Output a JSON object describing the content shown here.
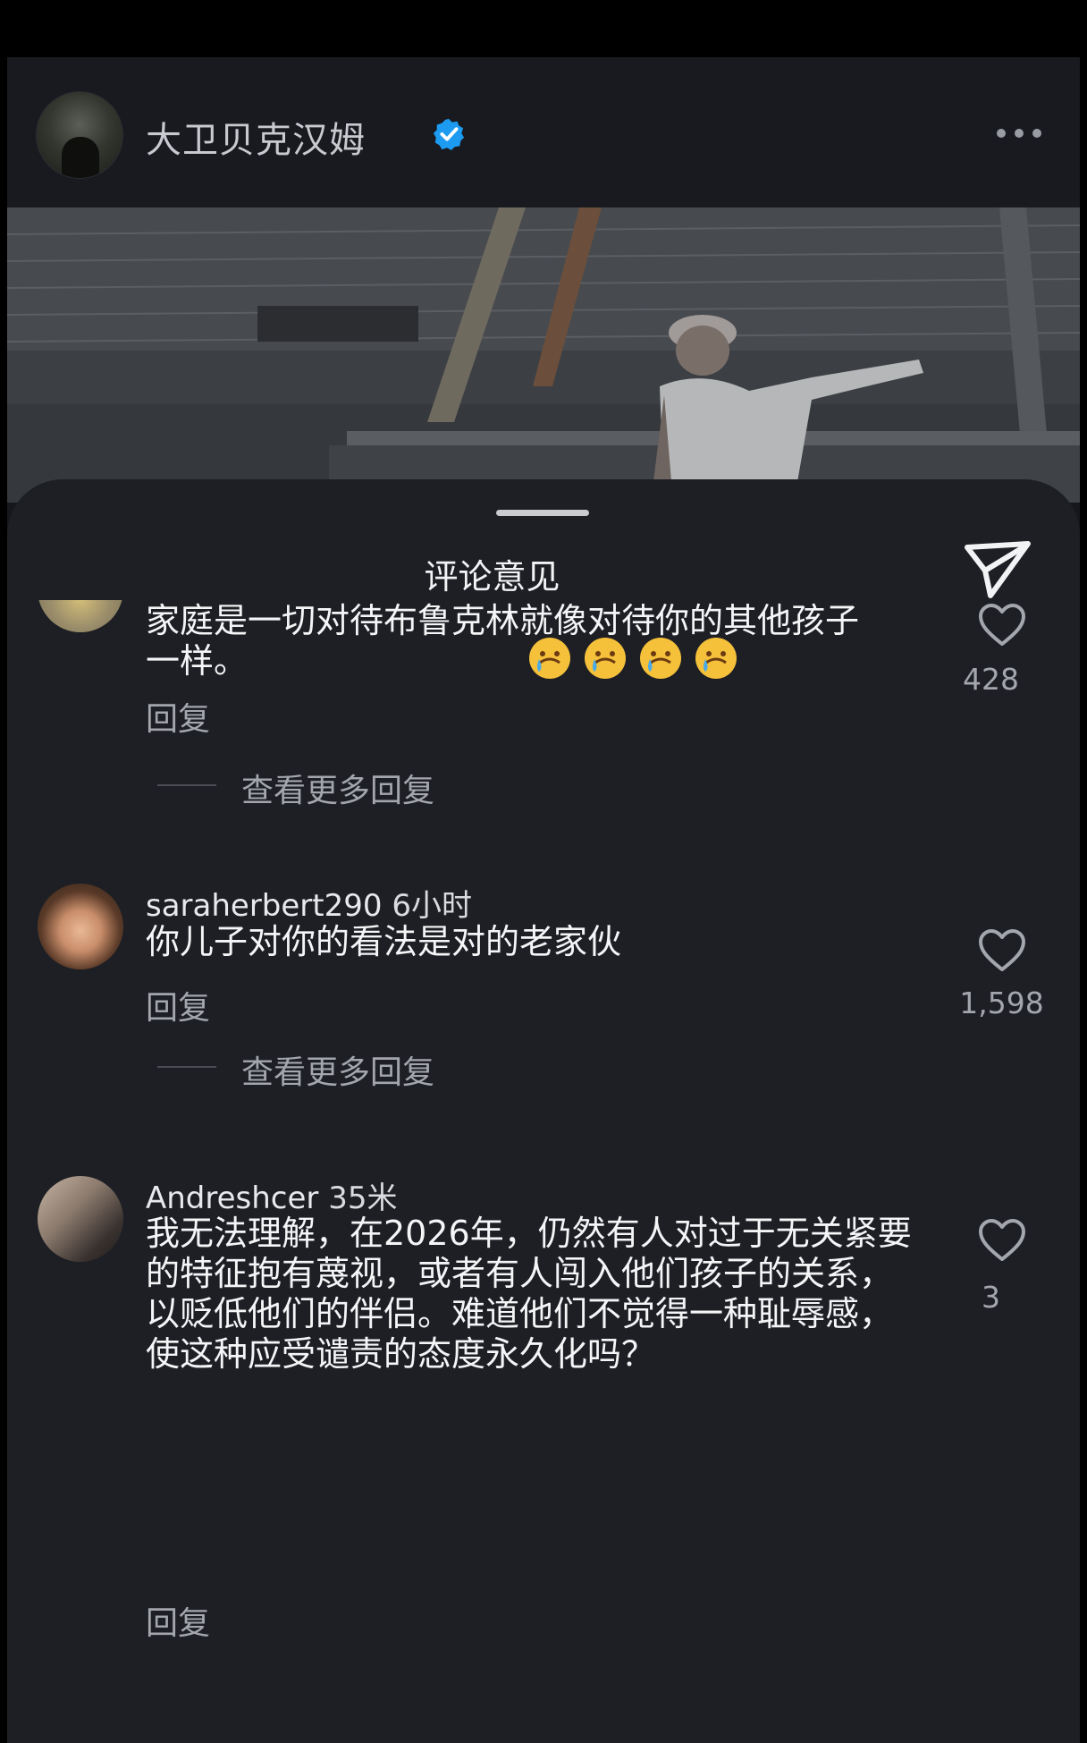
{
  "header": {
    "name": "大卫贝克汉姆",
    "verified_icon": "verified-badge-icon",
    "more_icon": "more-horizontal-icon"
  },
  "photo": {
    "description_icon": "stadium-photo"
  },
  "sheet": {
    "title": "评论意见",
    "send_icon": "send-icon"
  },
  "comments": [
    {
      "text": "家庭是一切对待布鲁克林就像对待你的其他孩子一样。",
      "emojis": [
        "crying-face",
        "crying-face",
        "crying-face",
        "crying-face"
      ],
      "reply_label": "回复",
      "more_replies_label": "查看更多回复",
      "likes": "428"
    },
    {
      "username": "saraherbert290",
      "time": "6小时",
      "text": "你儿子对你的看法是对的老家伙",
      "reply_label": "回复",
      "more_replies_label": "查看更多回复",
      "likes": "1,598"
    },
    {
      "username": "Andreshcer",
      "time": "35米",
      "text": "我无法理解，在2026年，仍然有人对过于无关紧要的特征抱有蔑视，或者有人闯入他们孩子的关系，以贬低他们的伴侣。难道他们不觉得一种耻辱感，使这种应受谴责的态度永久化吗？",
      "reply_label": "回复",
      "likes": "3"
    }
  ],
  "colors": {
    "background": "#15171c",
    "sheet": "#1d1f24",
    "muted_text": "#a3a6ad",
    "verified": "#1d9bf0"
  }
}
